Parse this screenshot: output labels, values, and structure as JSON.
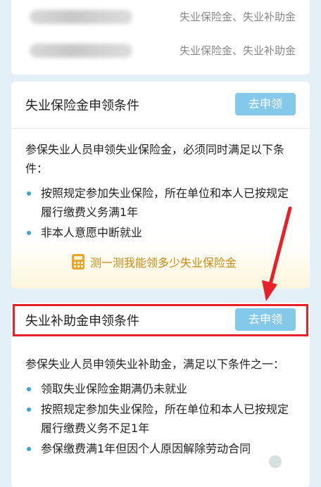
{
  "top_card": {
    "rows": [
      {
        "benefits": "失业保险金、失业补助金"
      },
      {
        "benefits": "失业保险金、失业补助金"
      }
    ]
  },
  "insurance_card": {
    "title": "失业保险金申领条件",
    "apply_label": "去申领",
    "description": "参保失业人员申领失业保险金，必须同时满足以下条件：",
    "conditions": [
      "按照规定参加失业保险，所在单位和本人已按规定履行缴费义务满1年",
      "非本人意愿中断就业"
    ],
    "calc_label": "测一测我能领多少失业保险金"
  },
  "subsidy_card": {
    "title": "失业补助金申领条件",
    "apply_label": "去申领",
    "description": "参保失业人员申领失业补助金，满足以下条件之一：",
    "conditions": [
      "领取失业保险金期满仍未就业",
      "按照规定参加失业保险，所在单位和本人已按规定履行缴费义务不足1年",
      "参保缴费满1年但因个人原因解除劳动合同"
    ]
  },
  "colors": {
    "background": "#e4f0f8",
    "button": "#84c9e9",
    "bullet": "#3aa3d9",
    "calc_text": "#c68a12",
    "annotation_red": "#e8202a"
  },
  "icons": {
    "calc": "calculator-icon"
  }
}
